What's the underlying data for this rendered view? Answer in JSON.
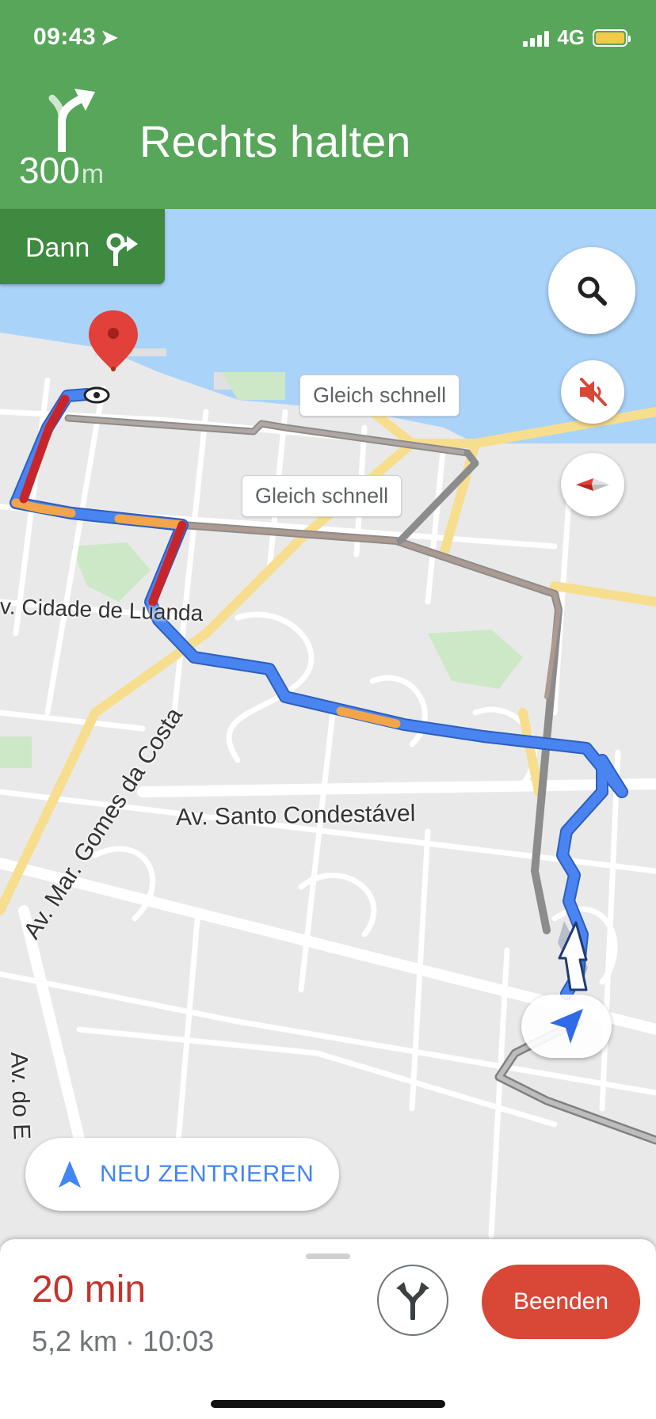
{
  "status_bar": {
    "time": "09:43",
    "network": "4G"
  },
  "navigation": {
    "distance_value": "300",
    "distance_unit": "m",
    "instruction": "Rechts halten",
    "then_label": "Dann",
    "header_color": "#57a65a"
  },
  "map": {
    "route_callouts": [
      "Gleich schnell",
      "Gleich schnell"
    ],
    "street_labels": {
      "cidade_de_luanda": "v. Cidade de Luanda",
      "gomes_da_costa": "Av. Mar. Gomes da Costa",
      "santo_condestavel": "Av. Santo Condestável",
      "av_do": "Av. do E"
    },
    "colors": {
      "route": "#4a84f0",
      "traffic_slow": "#f2a54a",
      "traffic_heavy": "#c8252b",
      "alternative": "#9aa0a6",
      "water": "#aad3fa"
    }
  },
  "controls": {
    "search_icon": "search-icon",
    "mute_icon": "volume-off-icon",
    "compass_icon": "compass-icon",
    "recenter_label": "NEU ZENTRIEREN"
  },
  "trip": {
    "eta_duration": "20 min",
    "eta_details": "5,2 km · 10:03",
    "end_button": "Beenden",
    "alternatives_icon": "fork-routes-icon"
  }
}
